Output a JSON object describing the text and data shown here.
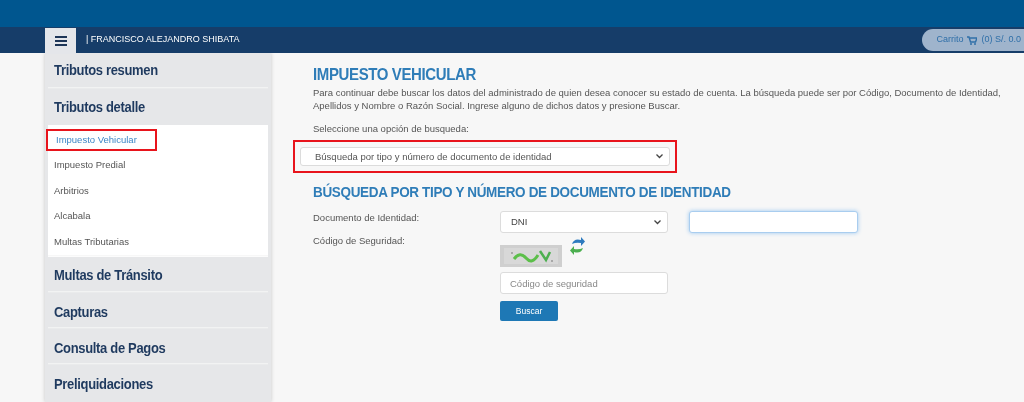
{
  "header": {
    "user_name": "| FRANCISCO ALEJANDRO SHIBATA",
    "cart": {
      "label": "Carrito",
      "summary": "(0) S/. 0.0"
    }
  },
  "sidebar": {
    "items": [
      {
        "label": "Tributos resumen"
      },
      {
        "label": "Tributos detalle",
        "children": [
          {
            "label": "Impuesto Vehicular",
            "selected": true,
            "highlighted": true
          },
          {
            "label": "Impuesto Predial",
            "selected": false,
            "highlighted": false
          },
          {
            "label": "Arbitrios",
            "selected": false,
            "highlighted": false
          },
          {
            "label": "Alcabala",
            "selected": false,
            "highlighted": false
          },
          {
            "label": "Multas Tributarias",
            "selected": false,
            "highlighted": false
          }
        ]
      },
      {
        "label": "Multas de Tránsito"
      },
      {
        "label": "Capturas"
      },
      {
        "label": "Consulta de Pagos"
      },
      {
        "label": "Preliquidaciones"
      }
    ]
  },
  "main": {
    "title": "IMPUESTO VEHICULAR",
    "intro": "Para continuar debe buscar los datos del administrado de quien desea conocer su estado de cuenta. La búsqueda puede ser por Código, Documento de Identidad, Apellidos y Nombre o Razón Social. Ingrese alguno de dichos datos y presione Buscar.",
    "search_option": {
      "label": "Seleccione una opción de busqueda:",
      "value": "Búsqueda por tipo y número de documento de identidad",
      "highlighted": true
    },
    "section_title": "BÚSQUEDA POR TIPO Y NÚMERO DE DOCUMENTO DE IDENTIDAD",
    "document": {
      "label": "Documento de Identidad:",
      "type": "DNI"
    },
    "security": {
      "label": "Código de Seguridad:",
      "placeholder": "Código de seguridad"
    },
    "button": "Buscar"
  }
}
